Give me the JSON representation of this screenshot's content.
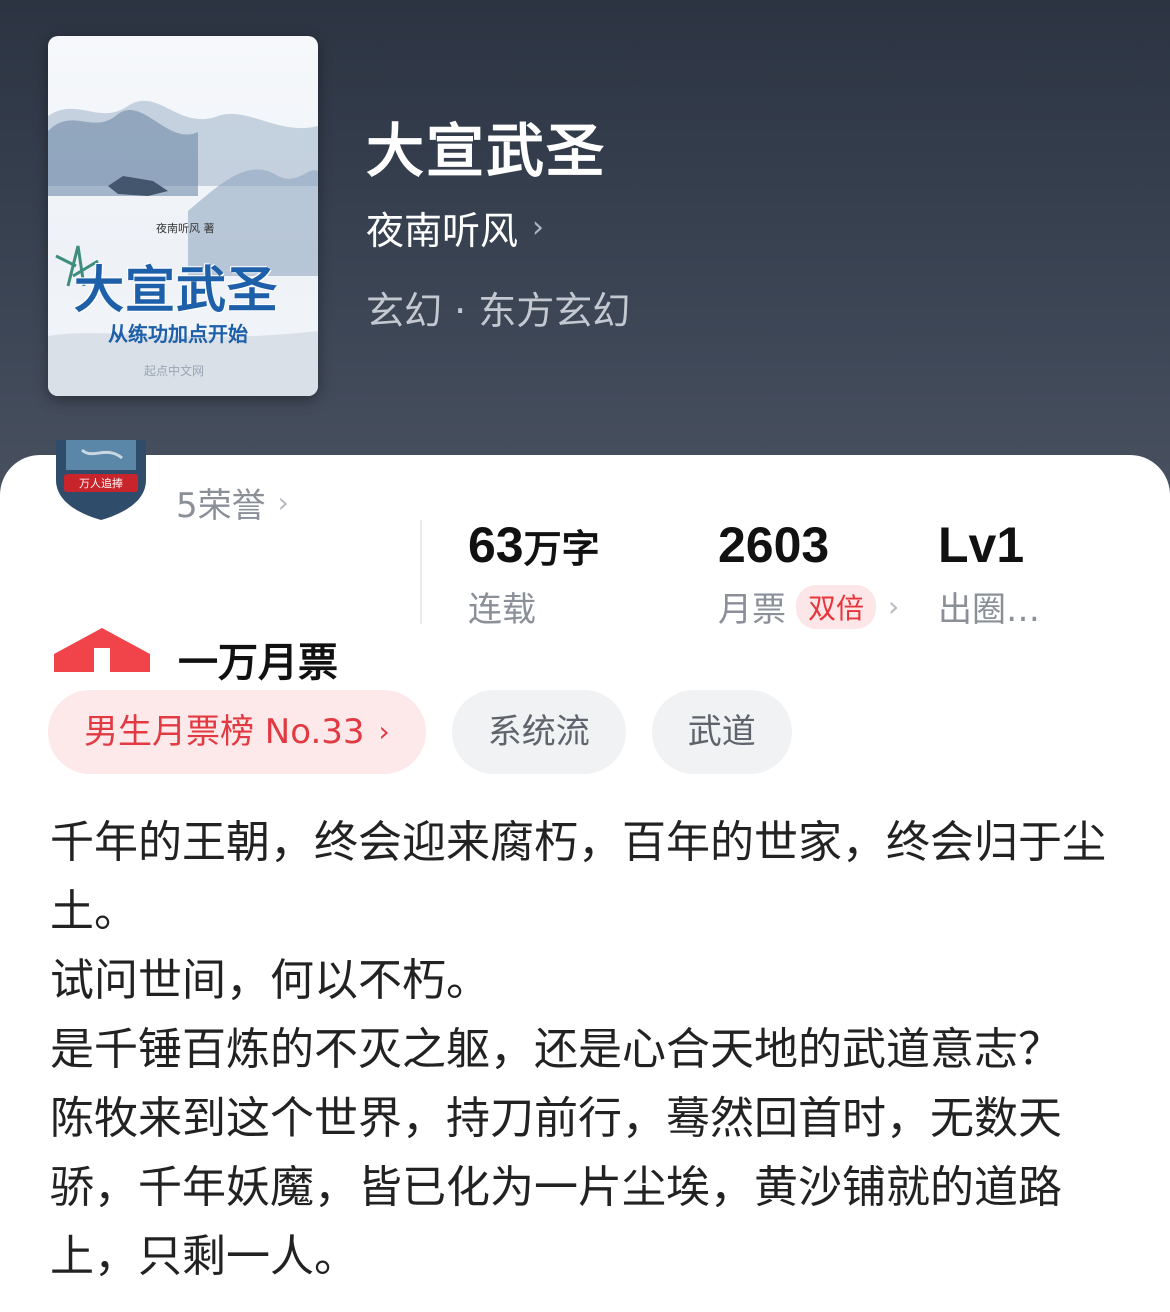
{
  "book": {
    "title": "大宣武圣",
    "author": "夜南听风",
    "genre": "玄幻 · 东方玄幻"
  },
  "cover": {
    "author_line": "夜南听风 著",
    "title": "大宣武圣",
    "subtitle": "从练功加点开始",
    "publisher": "起点中文网"
  },
  "honor": {
    "badge_text": "万人追捧",
    "label": "5荣誉"
  },
  "stats": [
    {
      "num": "63",
      "unit": "万字",
      "label": "连载"
    },
    {
      "num": "2603",
      "unit": "",
      "label": "月票",
      "badge": "双倍"
    },
    {
      "num": "Lv1",
      "unit": "",
      "label": "出圈…"
    }
  ],
  "monthly": {
    "title": "一万月票"
  },
  "tags": {
    "rank": "男生月票榜 No.33",
    "tag1": "系统流",
    "tag2": "武道"
  },
  "description": [
    "千年的王朝，终会迎来腐朽，百年的世家，终会归于尘土。",
    "试问世间，何以不朽。",
    "是千锤百炼的不灭之躯，还是心合天地的武道意志？",
    "陈牧来到这个世界，持刀前行，蓦然回首时，无数天骄，千年妖魔，皆已化为一片尘埃，黄沙铺就的道路上，只剩一人。"
  ],
  "colors": {
    "header_bg": "#3a4453",
    "accent_red": "#e23a42",
    "tag_bg": "#f1f2f4"
  }
}
